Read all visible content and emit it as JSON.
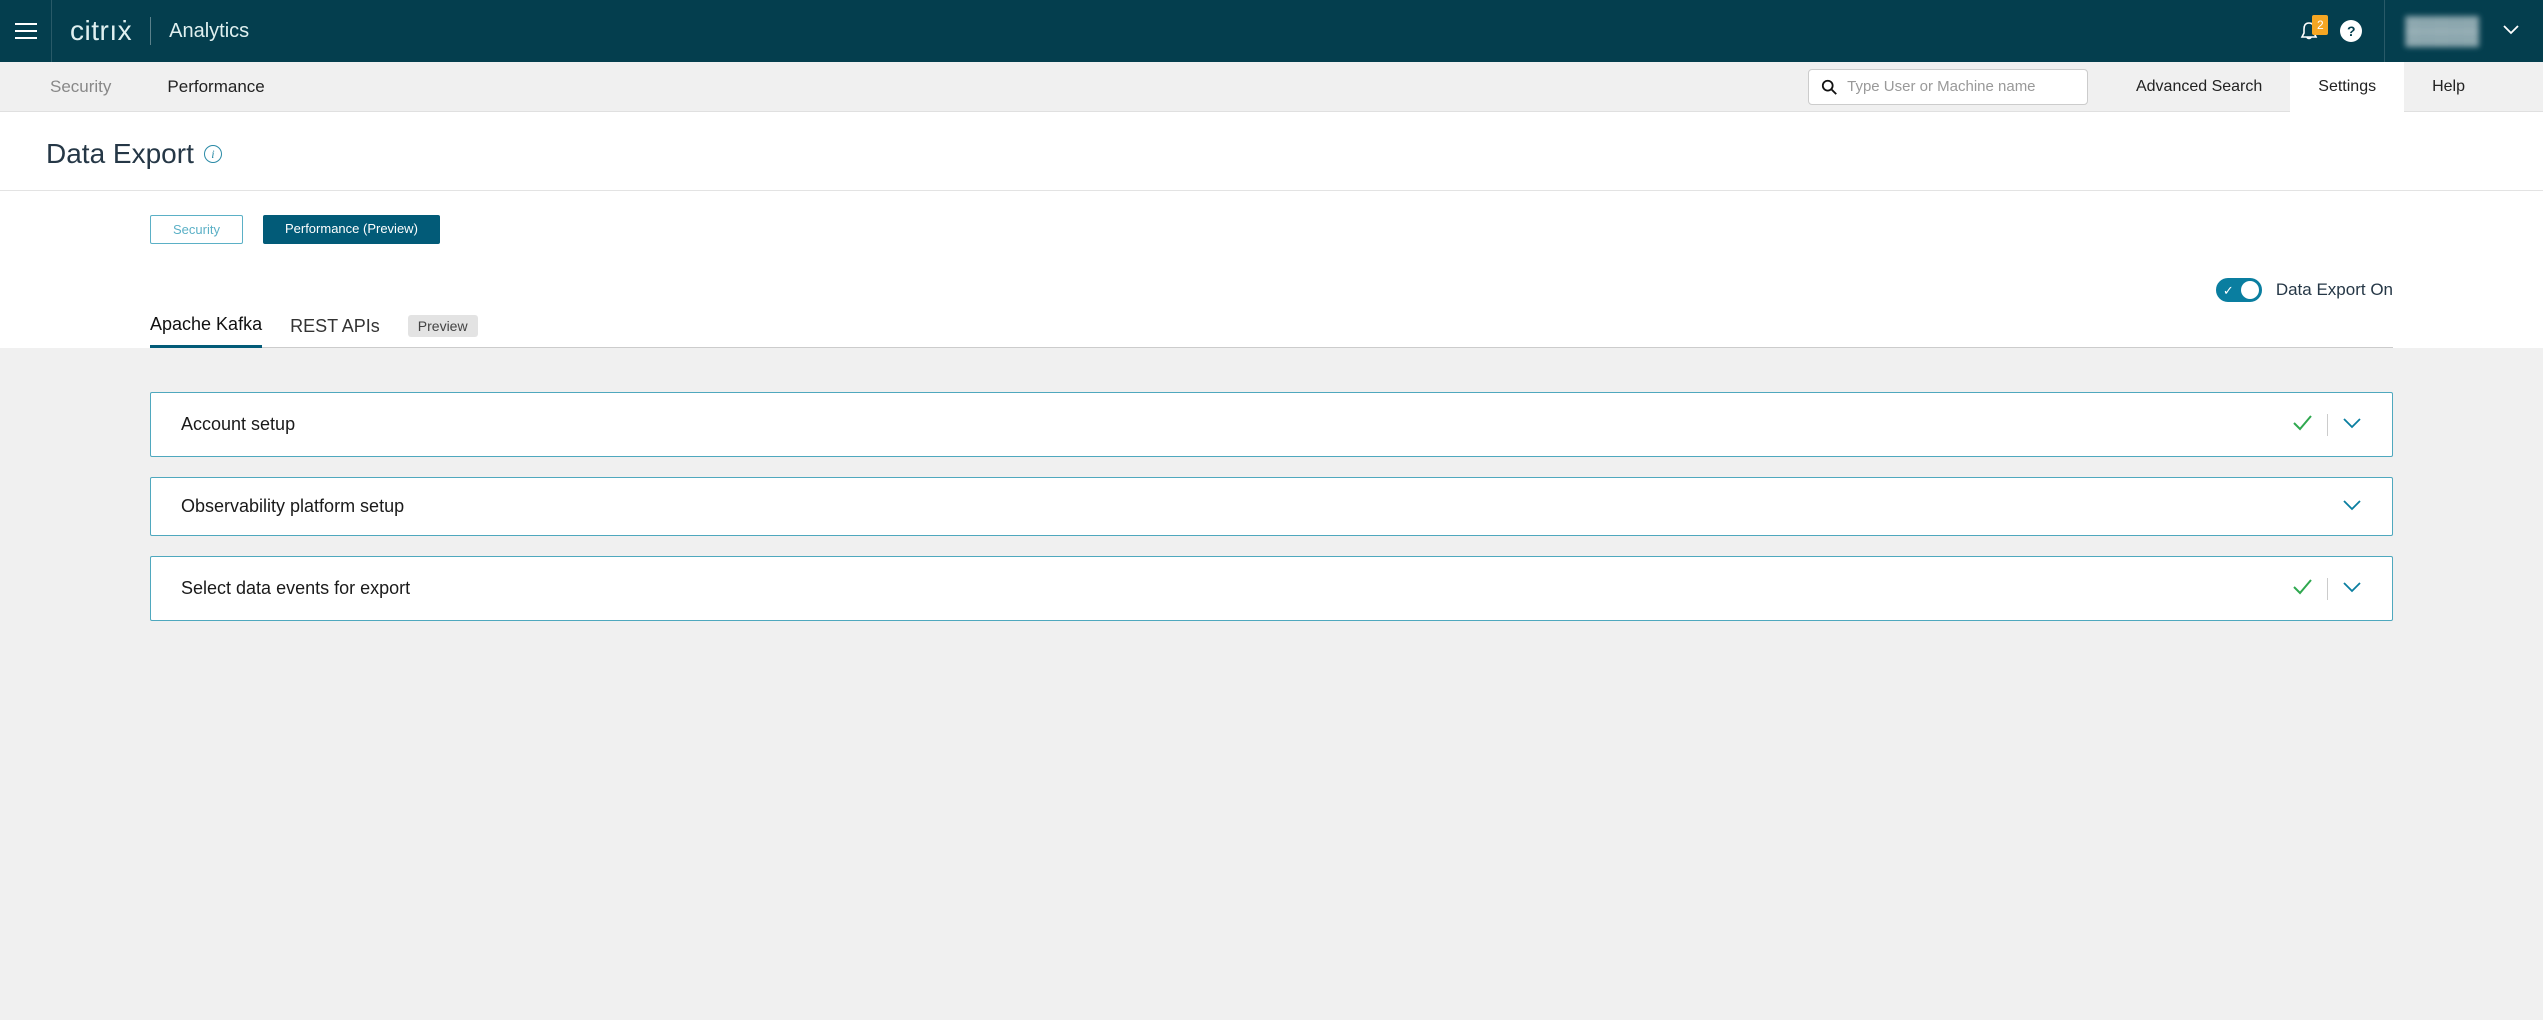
{
  "header": {
    "brand": "citrıẋ",
    "app": "Analytics",
    "notification_count": "2",
    "user_line1": "████████",
    "user_line2": "████████"
  },
  "subnav": {
    "tabs": {
      "security": "Security",
      "performance": "Performance"
    },
    "search_placeholder": "Type User or Machine name",
    "advanced": "Advanced Search",
    "settings": "Settings",
    "help": "Help"
  },
  "page": {
    "title": "Data Export"
  },
  "pills": {
    "security": "Security",
    "performance": "Performance (Preview)"
  },
  "toggle": {
    "label": "Data Export On"
  },
  "tabs": {
    "kafka": "Apache Kafka",
    "rest": "REST APIs",
    "preview_badge": "Preview"
  },
  "panels": [
    {
      "title": "Account setup",
      "complete": true
    },
    {
      "title": "Observability platform setup",
      "complete": false
    },
    {
      "title": "Select data events for export",
      "complete": true
    }
  ]
}
